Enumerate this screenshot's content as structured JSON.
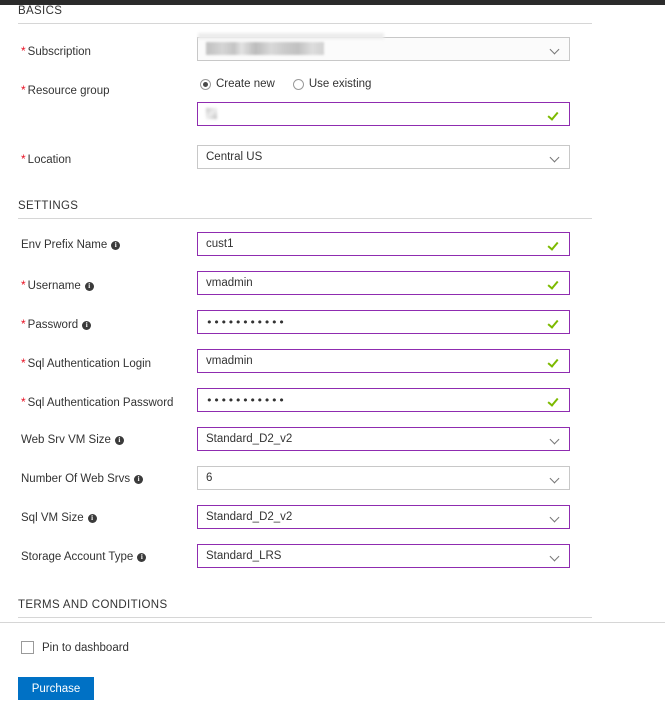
{
  "sections": {
    "basics": {
      "title": "BASICS",
      "fields": {
        "subscription": {
          "label": "Subscription",
          "required": true,
          "value": ""
        },
        "resource_group": {
          "label": "Resource group",
          "required": true,
          "options": [
            {
              "label": "Create new",
              "selected": true
            },
            {
              "label": "Use existing",
              "selected": false
            }
          ],
          "value": ""
        },
        "location": {
          "label": "Location",
          "required": true,
          "value": "Central US"
        }
      }
    },
    "settings": {
      "title": "SETTINGS",
      "fields": {
        "env_prefix_name": {
          "label": "Env Prefix Name",
          "required": false,
          "info": true,
          "value": "cust1"
        },
        "username": {
          "label": "Username",
          "required": true,
          "info": true,
          "value": "vmadmin"
        },
        "password": {
          "label": "Password",
          "required": true,
          "info": true,
          "value": "•••••••••••"
        },
        "sql_auth_login": {
          "label": "Sql Authentication Login",
          "required": true,
          "info": false,
          "value": "vmadmin"
        },
        "sql_auth_password": {
          "label": "Sql Authentication Password",
          "required": true,
          "info": false,
          "value": "•••••••••••"
        },
        "web_srv_vm_size": {
          "label": "Web Srv VM Size",
          "required": false,
          "info": true,
          "value": "Standard_D2_v2"
        },
        "number_of_web_srvs": {
          "label": "Number Of Web Srvs",
          "required": false,
          "info": true,
          "value": "6"
        },
        "sql_vm_size": {
          "label": "Sql VM Size",
          "required": false,
          "info": true,
          "value": "Standard_D2_v2"
        },
        "storage_account_type": {
          "label": "Storage Account Type",
          "required": false,
          "info": true,
          "value": "Standard_LRS"
        }
      }
    },
    "terms": {
      "title": "TERMS AND CONDITIONS",
      "pin_to_dashboard": {
        "label": "Pin to dashboard",
        "checked": false
      },
      "purchase_button": {
        "label": "Purchase"
      }
    }
  },
  "colors": {
    "accent_blue": "#0071c5",
    "valid_border": "#8f2cb0",
    "check_green": "#7cba00",
    "required_red": "#e81123",
    "topbar": "#2b2b2b",
    "rule": "#d6d6d6"
  }
}
